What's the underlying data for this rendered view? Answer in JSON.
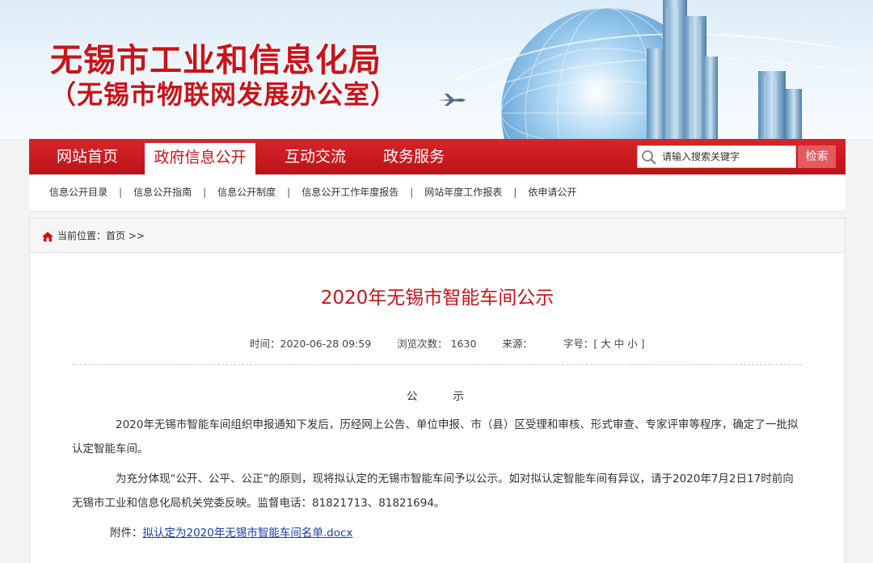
{
  "header": {
    "title": "无锡市工业和信息化局",
    "subtitle": "（无锡市物联网发展办公室）"
  },
  "nav": {
    "items": [
      "网站首页",
      "政府信息公开",
      "互动交流",
      "政务服务"
    ],
    "active_index": 1,
    "search_placeholder": "请输入搜索关键字",
    "search_button": "检索"
  },
  "subnav": {
    "items": [
      "信息公开目录",
      "信息公开指南",
      "信息公开制度",
      "信息公开工作年度报告",
      "网站年度工作报表",
      "依申请公开"
    ],
    "separator": "|"
  },
  "breadcrumb": {
    "text": "当前位置：首页 >>"
  },
  "article": {
    "title": "2020年无锡市智能车间公示",
    "meta": {
      "time": "时间：2020-06-28 09:59",
      "views": "浏览次数： 1630",
      "source": "来源：",
      "font_size": "字号：[ 大 中 小 ]"
    },
    "heading": "公示",
    "paragraphs": [
      "2020年无锡市智能车间组织申报通知下发后，历经网上公告、单位申报、市（县）区受理和审核、形式审查、专家评审等程序，确定了一批拟认定智能车间。",
      "为充分体现“公开、公平、公正”的原则，现将拟认定的无锡市智能车间予以公示。如对拟认定智能车间有异议，请于2020年7月2日17时前向无锡市工业和信息化局机关党委反映。监督电话：81821713、81821694。"
    ],
    "attachment_label": "附件：",
    "attachment_link": "拟认定为2020年无锡市智能车间名单.docx"
  },
  "colors": {
    "brand_red": "#c8141a",
    "nav_red": "#d01c22",
    "link_blue": "#1a3ea8"
  }
}
